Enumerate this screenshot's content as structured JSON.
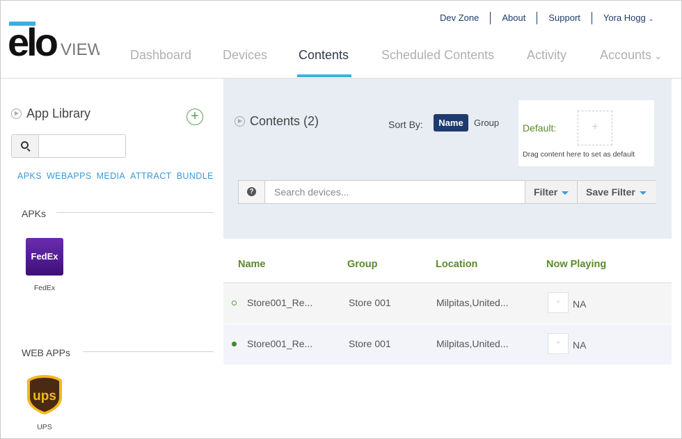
{
  "brand": {
    "logo_text": "elo",
    "logo_sub": "VIEW"
  },
  "top_links": [
    {
      "label": "Dev Zone"
    },
    {
      "label": "About"
    },
    {
      "label": "Support"
    },
    {
      "label": "Yora Hogg"
    }
  ],
  "main_nav": [
    {
      "label": "Dashboard"
    },
    {
      "label": "Devices"
    },
    {
      "label": "Contents",
      "active": true
    },
    {
      "label": "Scheduled Contents"
    },
    {
      "label": "Activity"
    },
    {
      "label": "Accounts"
    }
  ],
  "sidebar": {
    "title": "App Library",
    "search_placeholder": "",
    "filters": [
      "APKS",
      "WEBAPPS",
      "MEDIA",
      "ATTRACT",
      "BUNDLE"
    ],
    "sections": [
      {
        "header": "APKs",
        "apps": [
          {
            "name": "FedEx",
            "icon_text": "FedEx"
          }
        ]
      },
      {
        "header": "WEB APPs",
        "apps": [
          {
            "name": "UPS",
            "icon_text": "ups"
          }
        ]
      }
    ]
  },
  "contents": {
    "title": "Contents (2)",
    "sort_by_label": "Sort By:",
    "sort_options": [
      "Name",
      "Group"
    ],
    "sort_selected": "Name",
    "default_label": "Default:",
    "default_hint": "Drag content here to set as default",
    "search_placeholder": "Search devices...",
    "filter_label": "Filter",
    "save_filter_label": "Save Filter"
  },
  "table": {
    "columns": [
      "Name",
      "Group",
      "Location",
      "Now Playing"
    ],
    "rows": [
      {
        "status": "offline",
        "name": "Store001_Re...",
        "group": "Store 001",
        "location": "Milpitas,United...",
        "now_playing": "NA"
      },
      {
        "status": "online",
        "name": "Store001_Re...",
        "group": "Store 001",
        "location": "Milpitas,United...",
        "now_playing": "NA"
      }
    ]
  },
  "colors": {
    "accent_blue": "#3ab0e0",
    "brand_navy": "#1d3b6e",
    "header_green": "#5a8a2a",
    "fedex_purple": "#4d148c",
    "ups_brown": "#4a2a12",
    "ups_gold": "#f5b81c"
  }
}
